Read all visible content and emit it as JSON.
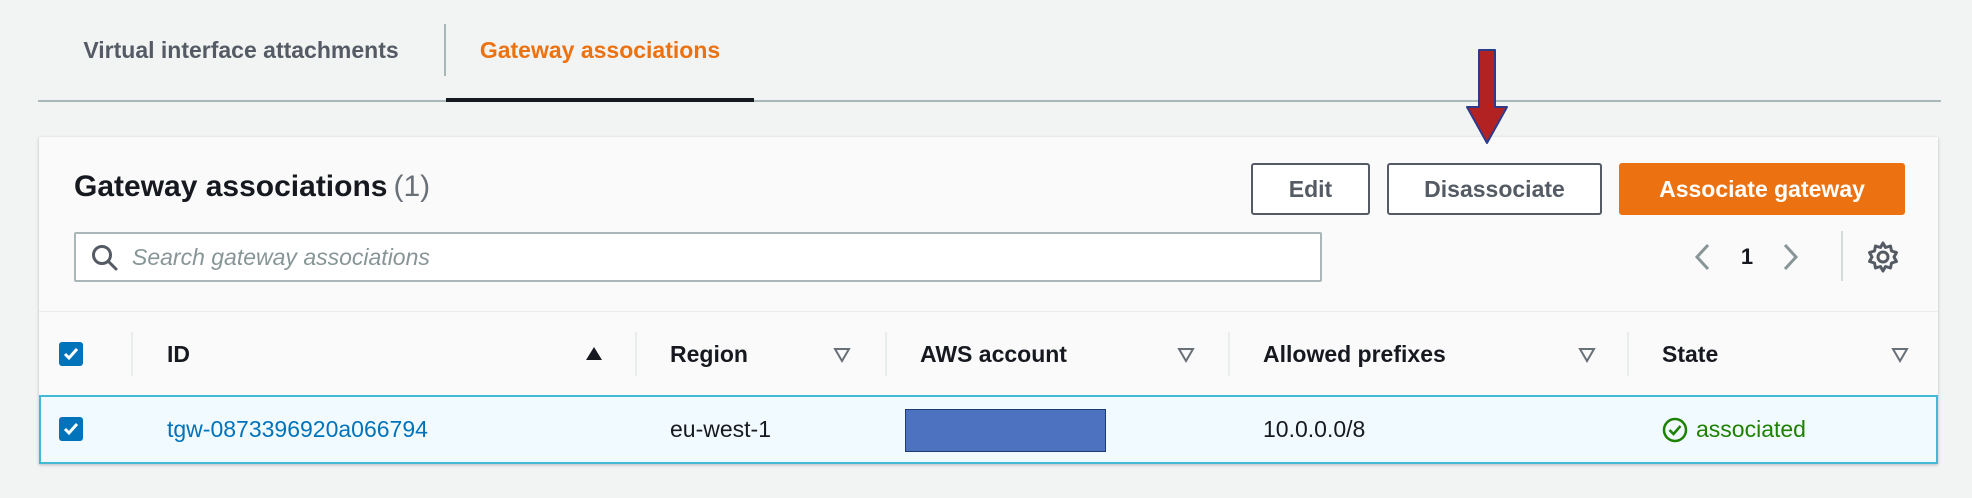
{
  "tabs": [
    {
      "label": "Virtual interface attachments",
      "active": false
    },
    {
      "label": "Gateway associations",
      "active": true
    }
  ],
  "panel": {
    "title": "Gateway associations",
    "count": "(1)",
    "buttons": {
      "edit": "Edit",
      "disassociate": "Disassociate",
      "associate": "Associate gateway"
    },
    "search": {
      "placeholder": "Search gateway associations",
      "value": ""
    },
    "pagination": {
      "current_page": "1"
    }
  },
  "table": {
    "columns": [
      {
        "key": "id",
        "label": "ID",
        "sort": "ascending"
      },
      {
        "key": "region",
        "label": "Region",
        "sort": "none"
      },
      {
        "key": "aws_account",
        "label": "AWS account",
        "sort": "none"
      },
      {
        "key": "allowed_prefixes",
        "label": "Allowed prefixes",
        "sort": "none"
      },
      {
        "key": "state",
        "label": "State",
        "sort": "none"
      }
    ],
    "select_all_checked": true,
    "rows": [
      {
        "selected": true,
        "id": "tgw-0873396920a066794",
        "region": "eu-west-1",
        "aws_account": "",
        "allowed_prefixes": "10.0.0.0/8",
        "state": "associated"
      }
    ]
  },
  "colors": {
    "accent_orange": "#ec7211",
    "link_blue": "#0073bb",
    "status_green": "#1d8102",
    "annotation_arrow": "#b22222",
    "redaction": "#4c72c0"
  },
  "icons": [
    "search-icon",
    "chevron-left-icon",
    "chevron-right-icon",
    "gear-icon",
    "sort-up-icon",
    "sort-down-icon",
    "check-circle-icon",
    "checkbox-checked-icon",
    "annotation-arrow-icon"
  ]
}
